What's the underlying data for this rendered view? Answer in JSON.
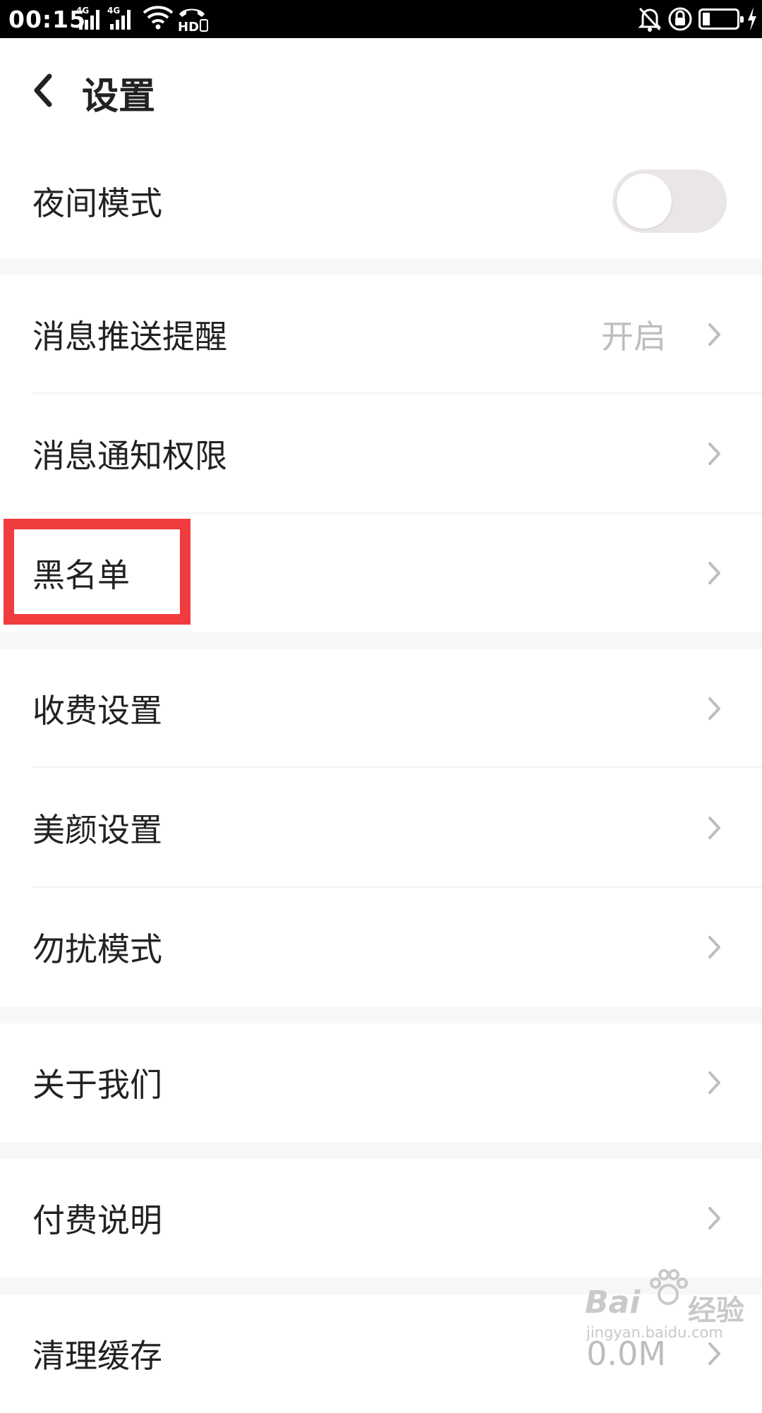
{
  "status_bar": {
    "time": "00:15",
    "signal1_tag": "4G",
    "signal2_tag": "4G",
    "hd_label": "HD",
    "icons": [
      "signal-4g-icon",
      "signal-4g-icon",
      "wifi-icon",
      "hd-call-icon",
      "bell-off-icon",
      "rotation-lock-icon",
      "battery-charging-icon"
    ]
  },
  "header": {
    "title": "设置",
    "back_icon": "chevron-left-icon"
  },
  "settings": {
    "night_mode": {
      "label": "夜间模式",
      "enabled": false
    },
    "push_reminder": {
      "label": "消息推送提醒",
      "value": "开启"
    },
    "notification_permission": {
      "label": "消息通知权限"
    },
    "blacklist": {
      "label": "黑名单"
    },
    "charge_settings": {
      "label": "收费设置"
    },
    "beauty_settings": {
      "label": "美颜设置"
    },
    "do_not_disturb": {
      "label": "勿扰模式"
    },
    "about_us": {
      "label": "关于我们"
    },
    "payment_info": {
      "label": "付费说明"
    },
    "clear_cache": {
      "label": "清理缓存",
      "value": "0.0M"
    }
  },
  "annotation": {
    "highlight_color": "#f03c3f",
    "target": "黑名单"
  },
  "watermark": {
    "brand": "Bai",
    "cn": "经验",
    "url": "jingyan.baidu.com"
  }
}
